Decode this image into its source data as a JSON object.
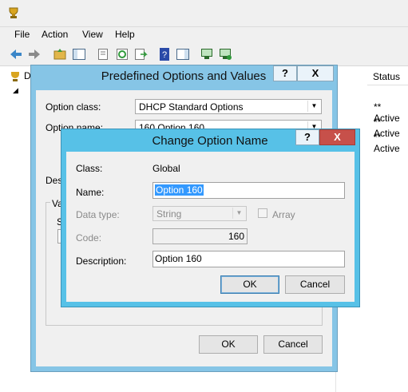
{
  "app": {
    "menu": [
      "File",
      "Action",
      "View",
      "Help"
    ]
  },
  "list": {
    "status_header": "Status",
    "rows": [
      "** Active",
      "** Active",
      "** Active"
    ],
    "tree_label": "D"
  },
  "predefined_dialog": {
    "title": "Predefined Options and Values",
    "help_label": "?",
    "close_label": "X",
    "option_class_label": "Option class:",
    "option_class_value": "DHCP Standard Options",
    "option_name_label": "Option name:",
    "option_name_value": "160 Option 160",
    "description_label": "Desc",
    "value_group_label": "Va",
    "value_sub_label": "S",
    "ok_label": "OK",
    "cancel_label": "Cancel"
  },
  "change_dialog": {
    "title": "Change Option Name",
    "help_label": "?",
    "close_label": "X",
    "class_label": "Class:",
    "class_value": "Global",
    "name_label": "Name:",
    "name_value": "Option 160",
    "data_type_label": "Data type:",
    "data_type_value": "String",
    "array_label": "Array",
    "code_label": "Code:",
    "code_value": "160",
    "description_label": "Description:",
    "description_value": "Option 160",
    "ok_label": "OK",
    "cancel_label": "Cancel"
  }
}
